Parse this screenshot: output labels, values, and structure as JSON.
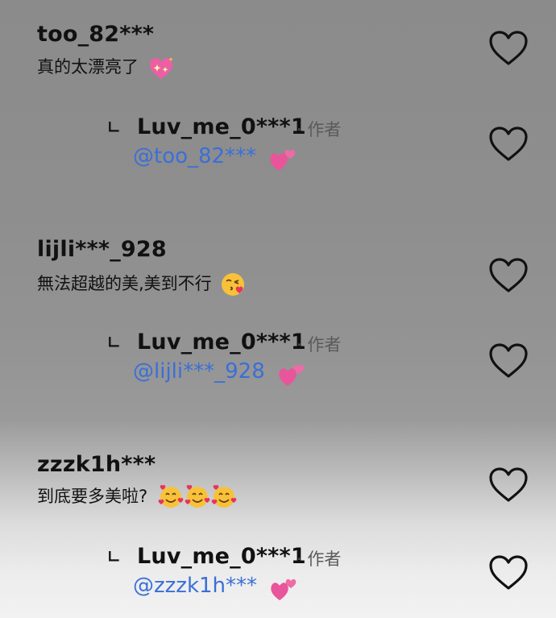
{
  "comments": [
    {
      "username": "too_82***",
      "text": "真的太漂亮了",
      "emoji": "sparkling-heart-icon",
      "reply": {
        "username": "Luv_me_0***1",
        "author_tag": "· 作者",
        "mention": "@too_82***",
        "emoji": "two-hearts-icon"
      }
    },
    {
      "username": "lijli***_928",
      "text": "無法超越的美,美到不行",
      "emoji": "face-blowing-kiss-icon",
      "reply": {
        "username": "Luv_me_0***1",
        "author_tag": "· 作者",
        "mention": "@lijli***_928",
        "emoji": "two-hearts-icon"
      }
    },
    {
      "username": "zzzk1h***",
      "text": "到底要多美啦?",
      "emoji": "smiling-face-with-hearts-icon",
      "reply": {
        "username": "Luv_me_0***1",
        "author_tag": "· 作者",
        "mention": "@zzzk1h***",
        "emoji": "two-hearts-icon"
      }
    }
  ],
  "reply_arrow": "∟",
  "colors": {
    "mention": "#3a6fd8",
    "heart_outline": "#111111",
    "pink": "#f06aa8"
  }
}
